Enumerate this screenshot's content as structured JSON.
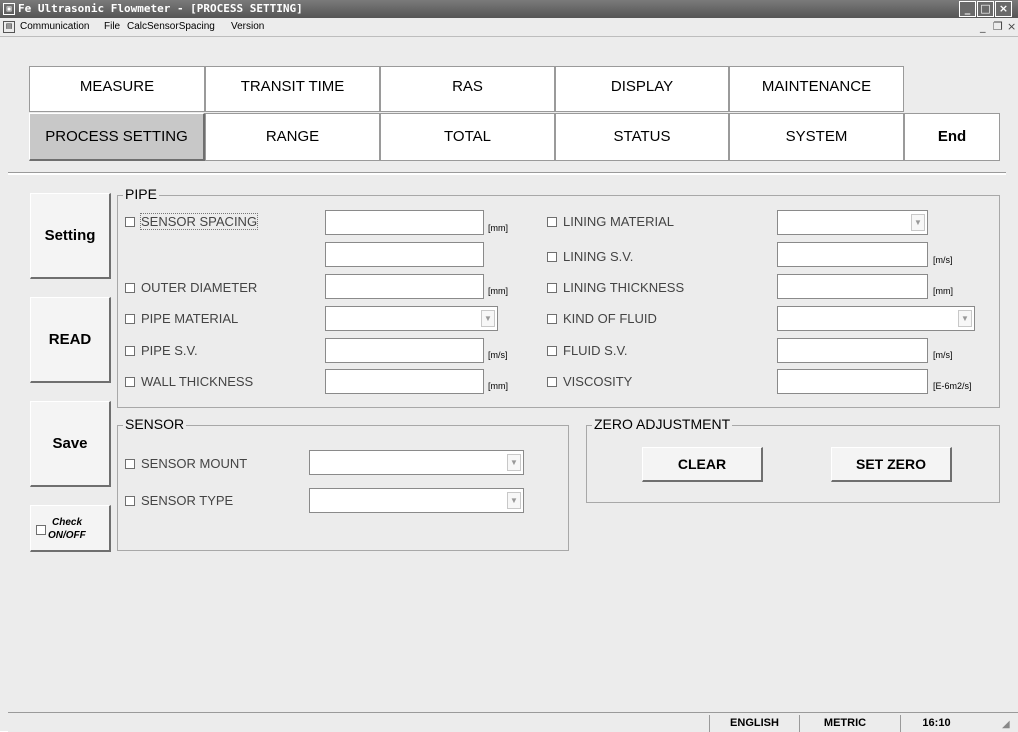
{
  "window": {
    "title": "Fe Ultrasonic Flowmeter - [PROCESS SETTING]",
    "minimize": "_",
    "maximize": "□",
    "close": "×"
  },
  "menu": {
    "items": [
      "Communication",
      "File",
      "CalcSensorSpacing",
      "Version"
    ],
    "mdi_min": "_",
    "mdi_restore": "❐",
    "mdi_close": "×"
  },
  "tabs": {
    "row1": [
      "MEASURE",
      "TRANSIT TIME",
      "RAS",
      "DISPLAY",
      "MAINTENANCE"
    ],
    "row2": [
      "PROCESS SETTING",
      "RANGE",
      "TOTAL",
      "STATUS",
      "SYSTEM",
      "End"
    ],
    "active": "PROCESS SETTING"
  },
  "side": {
    "setting": "Setting",
    "read": "READ",
    "save": "Save",
    "check_line1": "Check",
    "check_line2": "ON/OFF"
  },
  "pipe": {
    "title": "PIPE",
    "sensor_spacing": "SENSOR SPACING",
    "outer_diameter": "OUTER DIAMETER",
    "pipe_material": "PIPE MATERIAL",
    "pipe_sv": "PIPE S.V.",
    "wall_thickness": "WALL THICKNESS",
    "lining_material": "LINING MATERIAL",
    "lining_sv": "LINING S.V.",
    "lining_thickness": "LINING THICKNESS",
    "kind_of_fluid": "KIND OF FLUID",
    "fluid_sv": "FLUID S.V.",
    "viscosity": "VISCOSITY",
    "unit_mm": "[mm]",
    "unit_ms": "[m/s]",
    "unit_visc": "[E-6m2/s]"
  },
  "sensor": {
    "title": "SENSOR",
    "mount": "SENSOR MOUNT",
    "type": "SENSOR TYPE"
  },
  "zero": {
    "title": "ZERO ADJUSTMENT",
    "clear": "CLEAR",
    "set_zero": "SET ZERO"
  },
  "status": {
    "language": "ENGLISH",
    "units": "METRIC",
    "time": "16:10"
  }
}
